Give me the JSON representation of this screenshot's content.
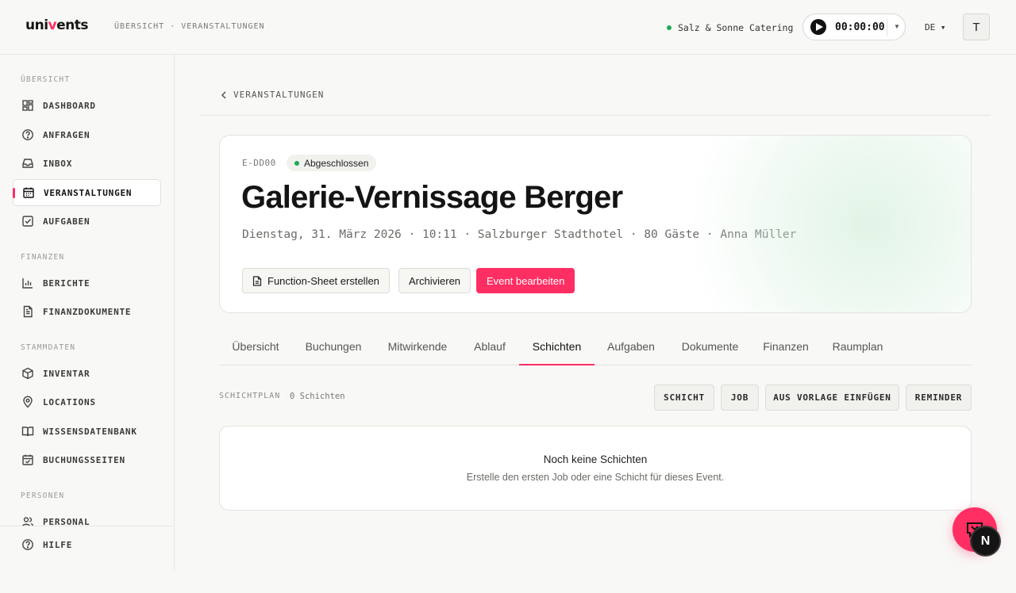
{
  "header": {
    "logo_prefix": "uni",
    "logo_accent": "v",
    "logo_suffix": "ents",
    "breadcrumb": "ÜBERSICHT · VERANSTALTUNGEN",
    "company": "Salz & Sonne Catering",
    "timer": "00:00:00",
    "language": "DE ▾",
    "avatar_initial": "T"
  },
  "sidebar": {
    "sections": [
      {
        "title": "ÜBERSICHT",
        "items": [
          {
            "label": "DASHBOARD",
            "icon": "dashboard-icon"
          },
          {
            "label": "ANFRAGEN",
            "icon": "question-icon"
          },
          {
            "label": "INBOX",
            "icon": "inbox-icon"
          },
          {
            "label": "VERANSTALTUNGEN",
            "icon": "calendar-icon",
            "active": true
          },
          {
            "label": "AUFGABEN",
            "icon": "checkbox-icon"
          }
        ]
      },
      {
        "title": "FINANZEN",
        "items": [
          {
            "label": "BERICHTE",
            "icon": "bar-chart-icon"
          },
          {
            "label": "FINANZDOKUMENTE",
            "icon": "document-icon"
          }
        ]
      },
      {
        "title": "STAMMDATEN",
        "items": [
          {
            "label": "INVENTAR",
            "icon": "box-icon"
          },
          {
            "label": "LOCATIONS",
            "icon": "map-pin-icon"
          },
          {
            "label": "WISSENSDATENBANK",
            "icon": "book-icon"
          },
          {
            "label": "BUCHUNGSSEITEN",
            "icon": "calendar-check-icon"
          }
        ]
      },
      {
        "title": "PERSONEN",
        "items": [
          {
            "label": "PERSONAL",
            "icon": "users-icon"
          }
        ]
      }
    ],
    "help": "HILFE"
  },
  "main": {
    "back_label": "VERANSTALTUNGEN",
    "event": {
      "id": "E-DD00",
      "status": "Abgeschlossen",
      "title": "Galerie-Vernissage Berger",
      "meta": "Dienstag, 31. März 2026 · 10:11 · Salzburger Stadthotel · 80 Gäste · Anna Müller",
      "buttons": {
        "function_sheet": "Function-Sheet erstellen",
        "archive": "Archivieren",
        "edit": "Event bearbeiten"
      }
    },
    "tabs": [
      "Übersicht",
      "Buchungen",
      "Mitwirkende",
      "Ablauf",
      "Schichten",
      "Aufgaben",
      "Dokumente",
      "Finanzen",
      "Raumplan"
    ],
    "active_tab": "Schichten",
    "shift_plan": {
      "label": "SCHICHTPLAN",
      "count": "0 Schichten",
      "actions": [
        "SCHICHT",
        "JOB",
        "AUS VORLAGE EINFÜGEN",
        "REMINDER"
      ],
      "empty_title": "Noch keine Schichten",
      "empty_subtitle": "Erstelle den ersten Job oder eine Schicht für dieses Event."
    }
  },
  "floating": {
    "chat_icon": "chat-icon",
    "badge": "N"
  },
  "colors": {
    "accent": "#ff2e63",
    "status_green": "#1faa53"
  }
}
